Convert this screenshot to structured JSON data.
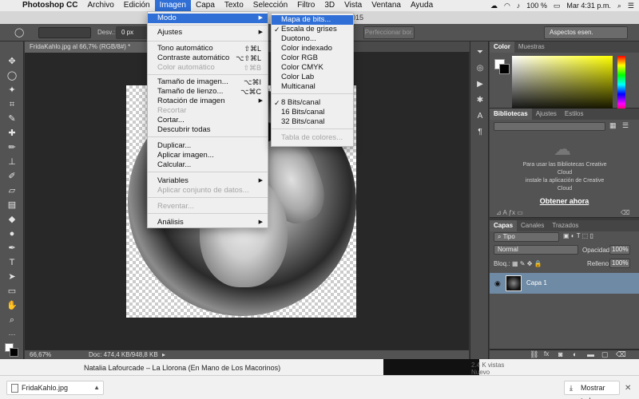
{
  "mac_menubar": {
    "app": "Photoshop CC",
    "items": [
      "Archivo",
      "Edición",
      "Imagen",
      "Capa",
      "Texto",
      "Selección",
      "Filtro",
      "3D",
      "Vista",
      "Ventana",
      "Ayuda"
    ],
    "battery": "100 %",
    "clock": "Mar 4:31 p.m."
  },
  "title_strip": {
    "text": "015"
  },
  "options_bar": {
    "desvan_label": "Desv.:",
    "desvan_value": "0 px",
    "perfeccionar": "Perfeccionar bor.",
    "workspace": "Aspectos esen."
  },
  "document": {
    "tab": "FridaKahlo.jpg al 66,7% (RGB/8#) *",
    "zoom": "66,67%",
    "doc_info": "Doc: 474,4 KB/948,8 KB"
  },
  "imagen_menu": {
    "items": [
      {
        "label": "Modo",
        "shortcut": "",
        "arrow": true,
        "disabled": false,
        "highlight": true
      },
      {
        "label": "Ajustes",
        "shortcut": "",
        "arrow": true,
        "disabled": false,
        "highlight": false
      },
      {
        "label": "Tono automático",
        "shortcut": "⇧⌘L",
        "arrow": false,
        "disabled": false,
        "highlight": false
      },
      {
        "label": "Contraste automático",
        "shortcut": "⌥⇧⌘L",
        "arrow": false,
        "disabled": false,
        "highlight": false
      },
      {
        "label": "Color automático",
        "shortcut": "⇧⌘B",
        "arrow": false,
        "disabled": true,
        "highlight": false
      },
      {
        "label": "Tamaño de imagen...",
        "shortcut": "⌥⌘I",
        "arrow": false,
        "disabled": false,
        "highlight": false
      },
      {
        "label": "Tamaño de lienzo...",
        "shortcut": "⌥⌘C",
        "arrow": false,
        "disabled": false,
        "highlight": false
      },
      {
        "label": "Rotación de imagen",
        "shortcut": "",
        "arrow": true,
        "disabled": false,
        "highlight": false
      },
      {
        "label": "Recortar",
        "shortcut": "",
        "arrow": false,
        "disabled": true,
        "highlight": false
      },
      {
        "label": "Cortar...",
        "shortcut": "",
        "arrow": false,
        "disabled": false,
        "highlight": false
      },
      {
        "label": "Descubrir todas",
        "shortcut": "",
        "arrow": false,
        "disabled": false,
        "highlight": false
      },
      {
        "label": "Duplicar...",
        "shortcut": "",
        "arrow": false,
        "disabled": false,
        "highlight": false
      },
      {
        "label": "Aplicar imagen...",
        "shortcut": "",
        "arrow": false,
        "disabled": false,
        "highlight": false
      },
      {
        "label": "Calcular...",
        "shortcut": "",
        "arrow": false,
        "disabled": false,
        "highlight": false
      },
      {
        "label": "Variables",
        "shortcut": "",
        "arrow": true,
        "disabled": false,
        "highlight": false
      },
      {
        "label": "Aplicar conjunto de datos...",
        "shortcut": "",
        "arrow": false,
        "disabled": true,
        "highlight": false
      },
      {
        "label": "Reventar...",
        "shortcut": "",
        "arrow": false,
        "disabled": true,
        "highlight": false
      },
      {
        "label": "Análisis",
        "shortcut": "",
        "arrow": true,
        "disabled": false,
        "highlight": false
      }
    ]
  },
  "modo_submenu": {
    "items": [
      {
        "label": "Mapa de bits...",
        "checked": false,
        "disabled": false,
        "highlight": true
      },
      {
        "label": "Escala de grises",
        "checked": true,
        "disabled": false,
        "highlight": false
      },
      {
        "label": "Duotono...",
        "checked": false,
        "disabled": false,
        "highlight": false
      },
      {
        "label": "Color indexado",
        "checked": false,
        "disabled": false,
        "highlight": false
      },
      {
        "label": "Color RGB",
        "checked": false,
        "disabled": false,
        "highlight": false
      },
      {
        "label": "Color CMYK",
        "checked": false,
        "disabled": false,
        "highlight": false
      },
      {
        "label": "Color Lab",
        "checked": false,
        "disabled": false,
        "highlight": false
      },
      {
        "label": "Multicanal",
        "checked": false,
        "disabled": false,
        "highlight": false
      },
      {
        "label": "8 Bits/canal",
        "checked": true,
        "disabled": false,
        "highlight": false
      },
      {
        "label": "16 Bits/canal",
        "checked": false,
        "disabled": false,
        "highlight": false
      },
      {
        "label": "32 Bits/canal",
        "checked": false,
        "disabled": false,
        "highlight": false
      },
      {
        "label": "Tabla de colores...",
        "checked": false,
        "disabled": true,
        "highlight": false
      }
    ]
  },
  "color_panel": {
    "tabs": [
      "Color",
      "Muestras"
    ]
  },
  "libraries_panel": {
    "tabs": [
      "Bibliotecas",
      "Ajustes",
      "Estilos"
    ],
    "message_line1": "Para usar las Bibliotecas Creative",
    "message_line2": "Cloud",
    "message_line3": "instale la aplicación de Creative",
    "message_line4": "Cloud",
    "link": "Obtener ahora"
  },
  "layers_panel": {
    "tabs": [
      "Capas",
      "Canales",
      "Trazados"
    ],
    "filter": "Tipo",
    "blend_mode": "Normal",
    "opacity_label": "Opacidad:",
    "opacity_value": "100%",
    "lock_label": "Bloq.:",
    "fill_label": "Relleno:",
    "fill_value": "100%",
    "layer_name": "Capa 1"
  },
  "browser_bottom": {
    "now_playing": "Natalia Lafourcade – La Llorona (En Mano de Los Macorinos)",
    "views": "2.4 K vistas",
    "nuevo": "Nuevo",
    "download_file": "FridaKahlo.jpg",
    "show_all": "Mostrar todas"
  }
}
